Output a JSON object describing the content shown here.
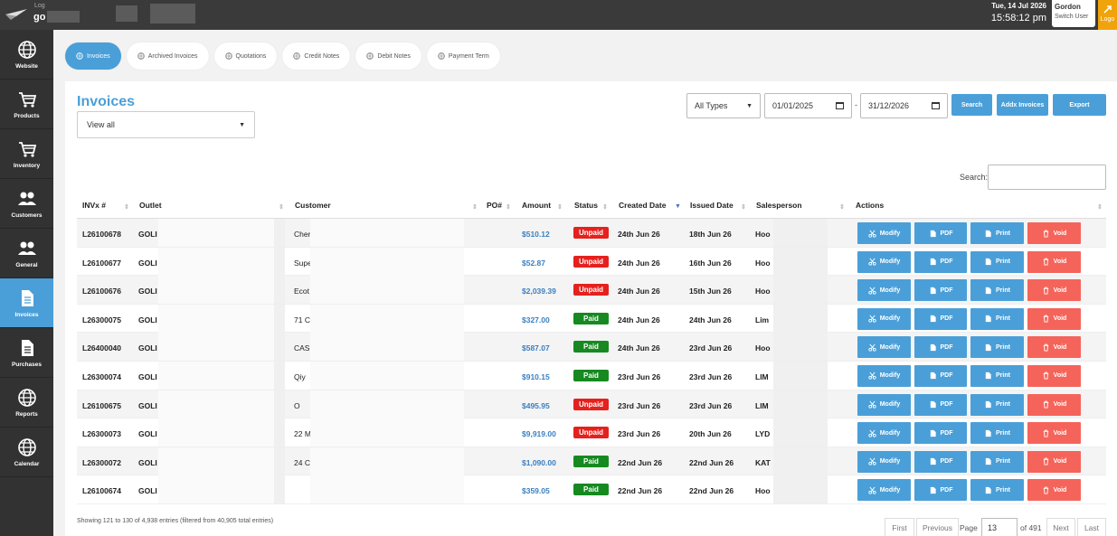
{
  "header": {
    "logo_caption": "Log",
    "logo_name": "go",
    "date": "Tue, 14 Jul 2026",
    "time": "15:58:12 pm",
    "user_name": "Gordon",
    "switch_user": "Switch User",
    "logout": "Logo"
  },
  "sidebar": {
    "items": [
      {
        "label": "Website",
        "icon": "globe-icon"
      },
      {
        "label": "Products",
        "icon": "cart-icon"
      },
      {
        "label": "Inventory",
        "icon": "cart-icon"
      },
      {
        "label": "Customers",
        "icon": "users-icon"
      },
      {
        "label": "General",
        "icon": "users-icon"
      },
      {
        "label": "Invoices",
        "icon": "document-icon",
        "active": true
      },
      {
        "label": "Purchases",
        "icon": "document-icon"
      },
      {
        "label": "Reports",
        "icon": "globe-icon"
      },
      {
        "label": "Calendar",
        "icon": "globe-icon"
      }
    ]
  },
  "tabs": [
    {
      "label": "Invoices",
      "active": true
    },
    {
      "label": "Archived Invoices"
    },
    {
      "label": "Quotations"
    },
    {
      "label": "Credit Notes"
    },
    {
      "label": "Debit Notes"
    },
    {
      "label": "Payment Term"
    }
  ],
  "panel": {
    "title": "Invoices",
    "view_filter": "View all",
    "type_filter": "All Types",
    "date_from": "01/01/2025",
    "date_sep": "-",
    "date_to": "31/12/2026",
    "search_btn": "Search",
    "add_btn": "Addx Invoices",
    "export_btn": "Export",
    "search_label": "Search:"
  },
  "table": {
    "columns": [
      "INVx #",
      "Outlet",
      "Customer",
      "PO#",
      "Amount",
      "Status",
      "Created Date",
      "Issued Date",
      "Salesperson",
      "Actions"
    ],
    "actions": {
      "modify": "Modify",
      "pdf": "PDF",
      "print": "Print",
      "void": "Void"
    },
    "rows": [
      {
        "inv": "L26100678",
        "outlet": "GOLI",
        "customer": "Cher",
        "amount": "$510.12",
        "status": "Unpaid",
        "created": "24th Jun 26",
        "issued": "18th Jun 26",
        "sales": "Hoo"
      },
      {
        "inv": "L26100677",
        "outlet": "GOLI",
        "customer": "Supe",
        "amount": "$52.87",
        "status": "Unpaid",
        "created": "24th Jun 26",
        "issued": "16th Jun 26",
        "sales": "Hoo"
      },
      {
        "inv": "L26100676",
        "outlet": "GOLI",
        "customer": "Ecot",
        "amount": "$2,039.39",
        "status": "Unpaid",
        "created": "24th Jun 26",
        "issued": "15th Jun 26",
        "sales": "Hoo"
      },
      {
        "inv": "L26300075",
        "outlet": "GOLI",
        "customer": "71 C",
        "amount": "$327.00",
        "status": "Paid",
        "created": "24th Jun 26",
        "issued": "24th Jun 26",
        "sales": "Lim"
      },
      {
        "inv": "L26400040",
        "outlet": "GOLI",
        "customer": "CAS",
        "amount": "$587.07",
        "status": "Paid",
        "created": "24th Jun 26",
        "issued": "23rd Jun 26",
        "sales": "Hoo"
      },
      {
        "inv": "L26300074",
        "outlet": "GOLI",
        "customer": "Qiy",
        "amount": "$910.15",
        "status": "Paid",
        "created": "23rd Jun 26",
        "issued": "23rd Jun 26",
        "sales": "LIM"
      },
      {
        "inv": "L26100675",
        "outlet": "GOLI",
        "customer": "O",
        "amount": "$495.95",
        "status": "Unpaid",
        "created": "23rd Jun 26",
        "issued": "23rd Jun 26",
        "sales": "LIM"
      },
      {
        "inv": "L26300073",
        "outlet": "GOLI",
        "customer": "22 M",
        "amount": "$9,919.00",
        "status": "Unpaid",
        "created": "23rd Jun 26",
        "issued": "20th Jun 26",
        "sales": "LYD"
      },
      {
        "inv": "L26300072",
        "outlet": "GOLI",
        "customer": "24 C",
        "amount": "$1,090.00",
        "status": "Paid",
        "created": "22nd Jun 26",
        "issued": "22nd Jun 26",
        "sales": "KAT"
      },
      {
        "inv": "L26100674",
        "outlet": "GOLI",
        "customer": "",
        "amount": "$359.05",
        "status": "Paid",
        "created": "22nd Jun 26",
        "issued": "22nd Jun 26",
        "sales": "Hoo"
      }
    ]
  },
  "footer": {
    "info": "Showing 121 to 130 of 4,938 entries (filtered from 40,905 total entries)",
    "first": "First",
    "previous": "Previous",
    "page_label": "Page",
    "page_value": "13",
    "of_label": "of 491",
    "next": "Next",
    "last": "Last"
  },
  "colors": {
    "accent": "#4a9fd8",
    "unpaid": "#e5211d",
    "paid": "#168a20",
    "void": "#f5645a",
    "sidebar": "#323232"
  }
}
